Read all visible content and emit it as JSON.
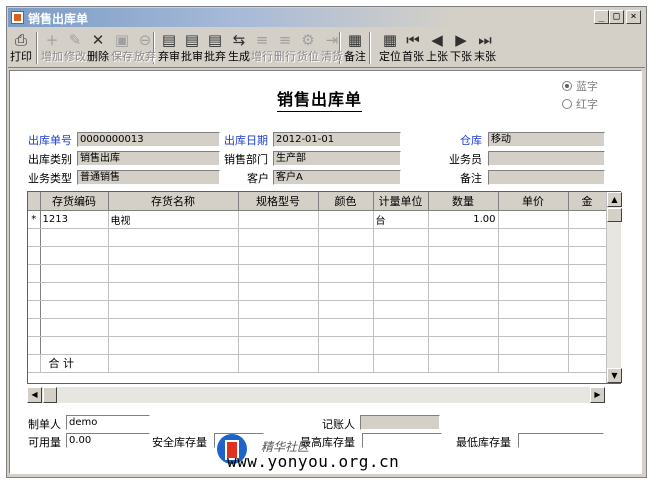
{
  "window": {
    "title": "销售出库单",
    "controls": [
      "_",
      "□",
      "×"
    ]
  },
  "toolbar": [
    {
      "label": "打印",
      "icon": "printer-icon",
      "glyph": "⎙",
      "enabled": true
    },
    {
      "label": "增加",
      "icon": "add-icon",
      "glyph": "+",
      "enabled": false
    },
    {
      "label": "修改",
      "icon": "edit-icon",
      "glyph": "✎",
      "enabled": false
    },
    {
      "label": "删除",
      "icon": "delete-icon",
      "glyph": "✕",
      "enabled": true
    },
    {
      "label": "保存",
      "icon": "save-icon",
      "glyph": "▣",
      "enabled": false
    },
    {
      "label": "放弃",
      "icon": "discard-icon",
      "glyph": "⊖",
      "enabled": false
    },
    {
      "label": "弃审",
      "icon": "unapprove-icon",
      "glyph": "▤",
      "enabled": true
    },
    {
      "label": "批审",
      "icon": "batch-approve-icon",
      "glyph": "▤",
      "enabled": true
    },
    {
      "label": "批弃",
      "icon": "batch-unapprove-icon",
      "glyph": "▤",
      "enabled": true
    },
    {
      "label": "生成",
      "icon": "generate-icon",
      "glyph": "⇆",
      "enabled": true
    },
    {
      "label": "增行",
      "icon": "add-row-icon",
      "glyph": "≡",
      "enabled": false
    },
    {
      "label": "删行",
      "icon": "delete-row-icon",
      "glyph": "≡",
      "enabled": false
    },
    {
      "label": "货位",
      "icon": "location-icon",
      "glyph": "⚙",
      "enabled": false
    },
    {
      "label": "清货",
      "icon": "clear-icon",
      "glyph": "⇥",
      "enabled": false
    },
    {
      "label": "备注",
      "icon": "note-icon",
      "glyph": "▦",
      "enabled": true
    },
    {
      "label": "定位",
      "icon": "locate-icon",
      "glyph": "▦",
      "enabled": true
    },
    {
      "label": "首张",
      "icon": "first-icon",
      "glyph": "⏮",
      "enabled": true
    },
    {
      "label": "上张",
      "icon": "prev-icon",
      "glyph": "◀",
      "enabled": true
    },
    {
      "label": "下张",
      "icon": "next-icon",
      "glyph": "▶",
      "enabled": true
    },
    {
      "label": "末张",
      "icon": "last-icon",
      "glyph": "⏭",
      "enabled": true
    }
  ],
  "doc_title": "销售出库单",
  "color_mode": {
    "blue_label": "蓝字",
    "red_label": "红字",
    "selected": "蓝字"
  },
  "header": {
    "doc_no_label": "出库单号",
    "doc_no": "0000000013",
    "doc_date_label": "出库日期",
    "doc_date": "2012-01-01",
    "warehouse_label": "仓库",
    "warehouse": "移动",
    "out_type_label": "出库类别",
    "out_type": "销售出库",
    "dept_label": "销售部门",
    "dept": "生产部",
    "salesman_label": "业务员",
    "salesman": "",
    "biz_type_label": "业务类型",
    "biz_type": "普通销售",
    "customer_label": "客户",
    "customer": "客户A",
    "remark_label": "备注",
    "remark": ""
  },
  "grid": {
    "columns": [
      "存货编码",
      "存货名称",
      "规格型号",
      "颜色",
      "计量单位",
      "数量",
      "单价",
      "金"
    ],
    "rows": [
      {
        "marker": "*",
        "cells": [
          "1213",
          "电视",
          "",
          "",
          "台",
          "1.00",
          "",
          ""
        ]
      }
    ],
    "total_label": "合  计"
  },
  "footer": {
    "maker_label": "制单人",
    "maker": "demo",
    "bookkeeper_label": "记账人",
    "bookkeeper": "",
    "available_label": "可用量",
    "available": "0.00",
    "safety_stock_label": "安全库存量",
    "safety_stock": "",
    "max_stock_label": "最高库存量",
    "max_stock": "",
    "min_stock_label": "最低库存量",
    "min_stock": ""
  },
  "watermark": {
    "url": "www.yonyou.org.cn",
    "cn": "精华社区"
  }
}
